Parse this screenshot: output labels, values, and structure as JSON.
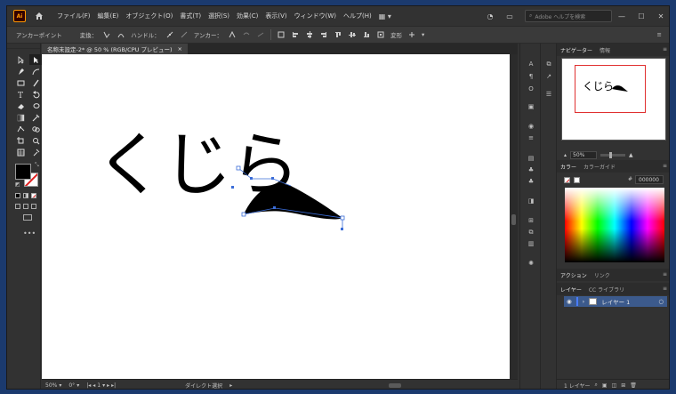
{
  "app": {
    "logo_text": "Ai",
    "brand_color": "#ff9a00"
  },
  "menu": {
    "items": [
      "ファイル(F)",
      "編集(E)",
      "オブジェクト(O)",
      "書式(T)",
      "選択(S)",
      "効果(C)",
      "表示(V)",
      "ウィンドウ(W)",
      "ヘルプ(H)"
    ],
    "search_placeholder": "Adobe ヘルプを検索"
  },
  "control_bar": {
    "anchor_point_label": "アンカーポイント",
    "convert_label": "変換：",
    "handle_label": "ハンドル：",
    "anchor_label": "アンカー：",
    "transform_label": "変形"
  },
  "document": {
    "tab_title": "名称未設定-2* @ 50 % (RGB/CPU プレビュー)",
    "close_glyph": "×",
    "text": "くじら"
  },
  "status_bar": {
    "zoom": "50%",
    "rotation": "0°",
    "artboard": "1",
    "current_tool": "ダイレクト選択"
  },
  "navigator": {
    "tabs": [
      "ナビゲーター",
      "情報"
    ],
    "zoom": "50%",
    "preview_text": "くじら"
  },
  "color": {
    "tabs": [
      "カラー",
      "カラーガイド"
    ],
    "hex_value": "000000"
  },
  "layers": {
    "top_tabs": [
      "アクション",
      "リンク"
    ],
    "tabs": [
      "レイヤー",
      "CC ライブラリ"
    ],
    "layer_name": "レイヤー 1",
    "count_label": "1 レイヤー",
    "selected_color": "#3c5a8c"
  }
}
